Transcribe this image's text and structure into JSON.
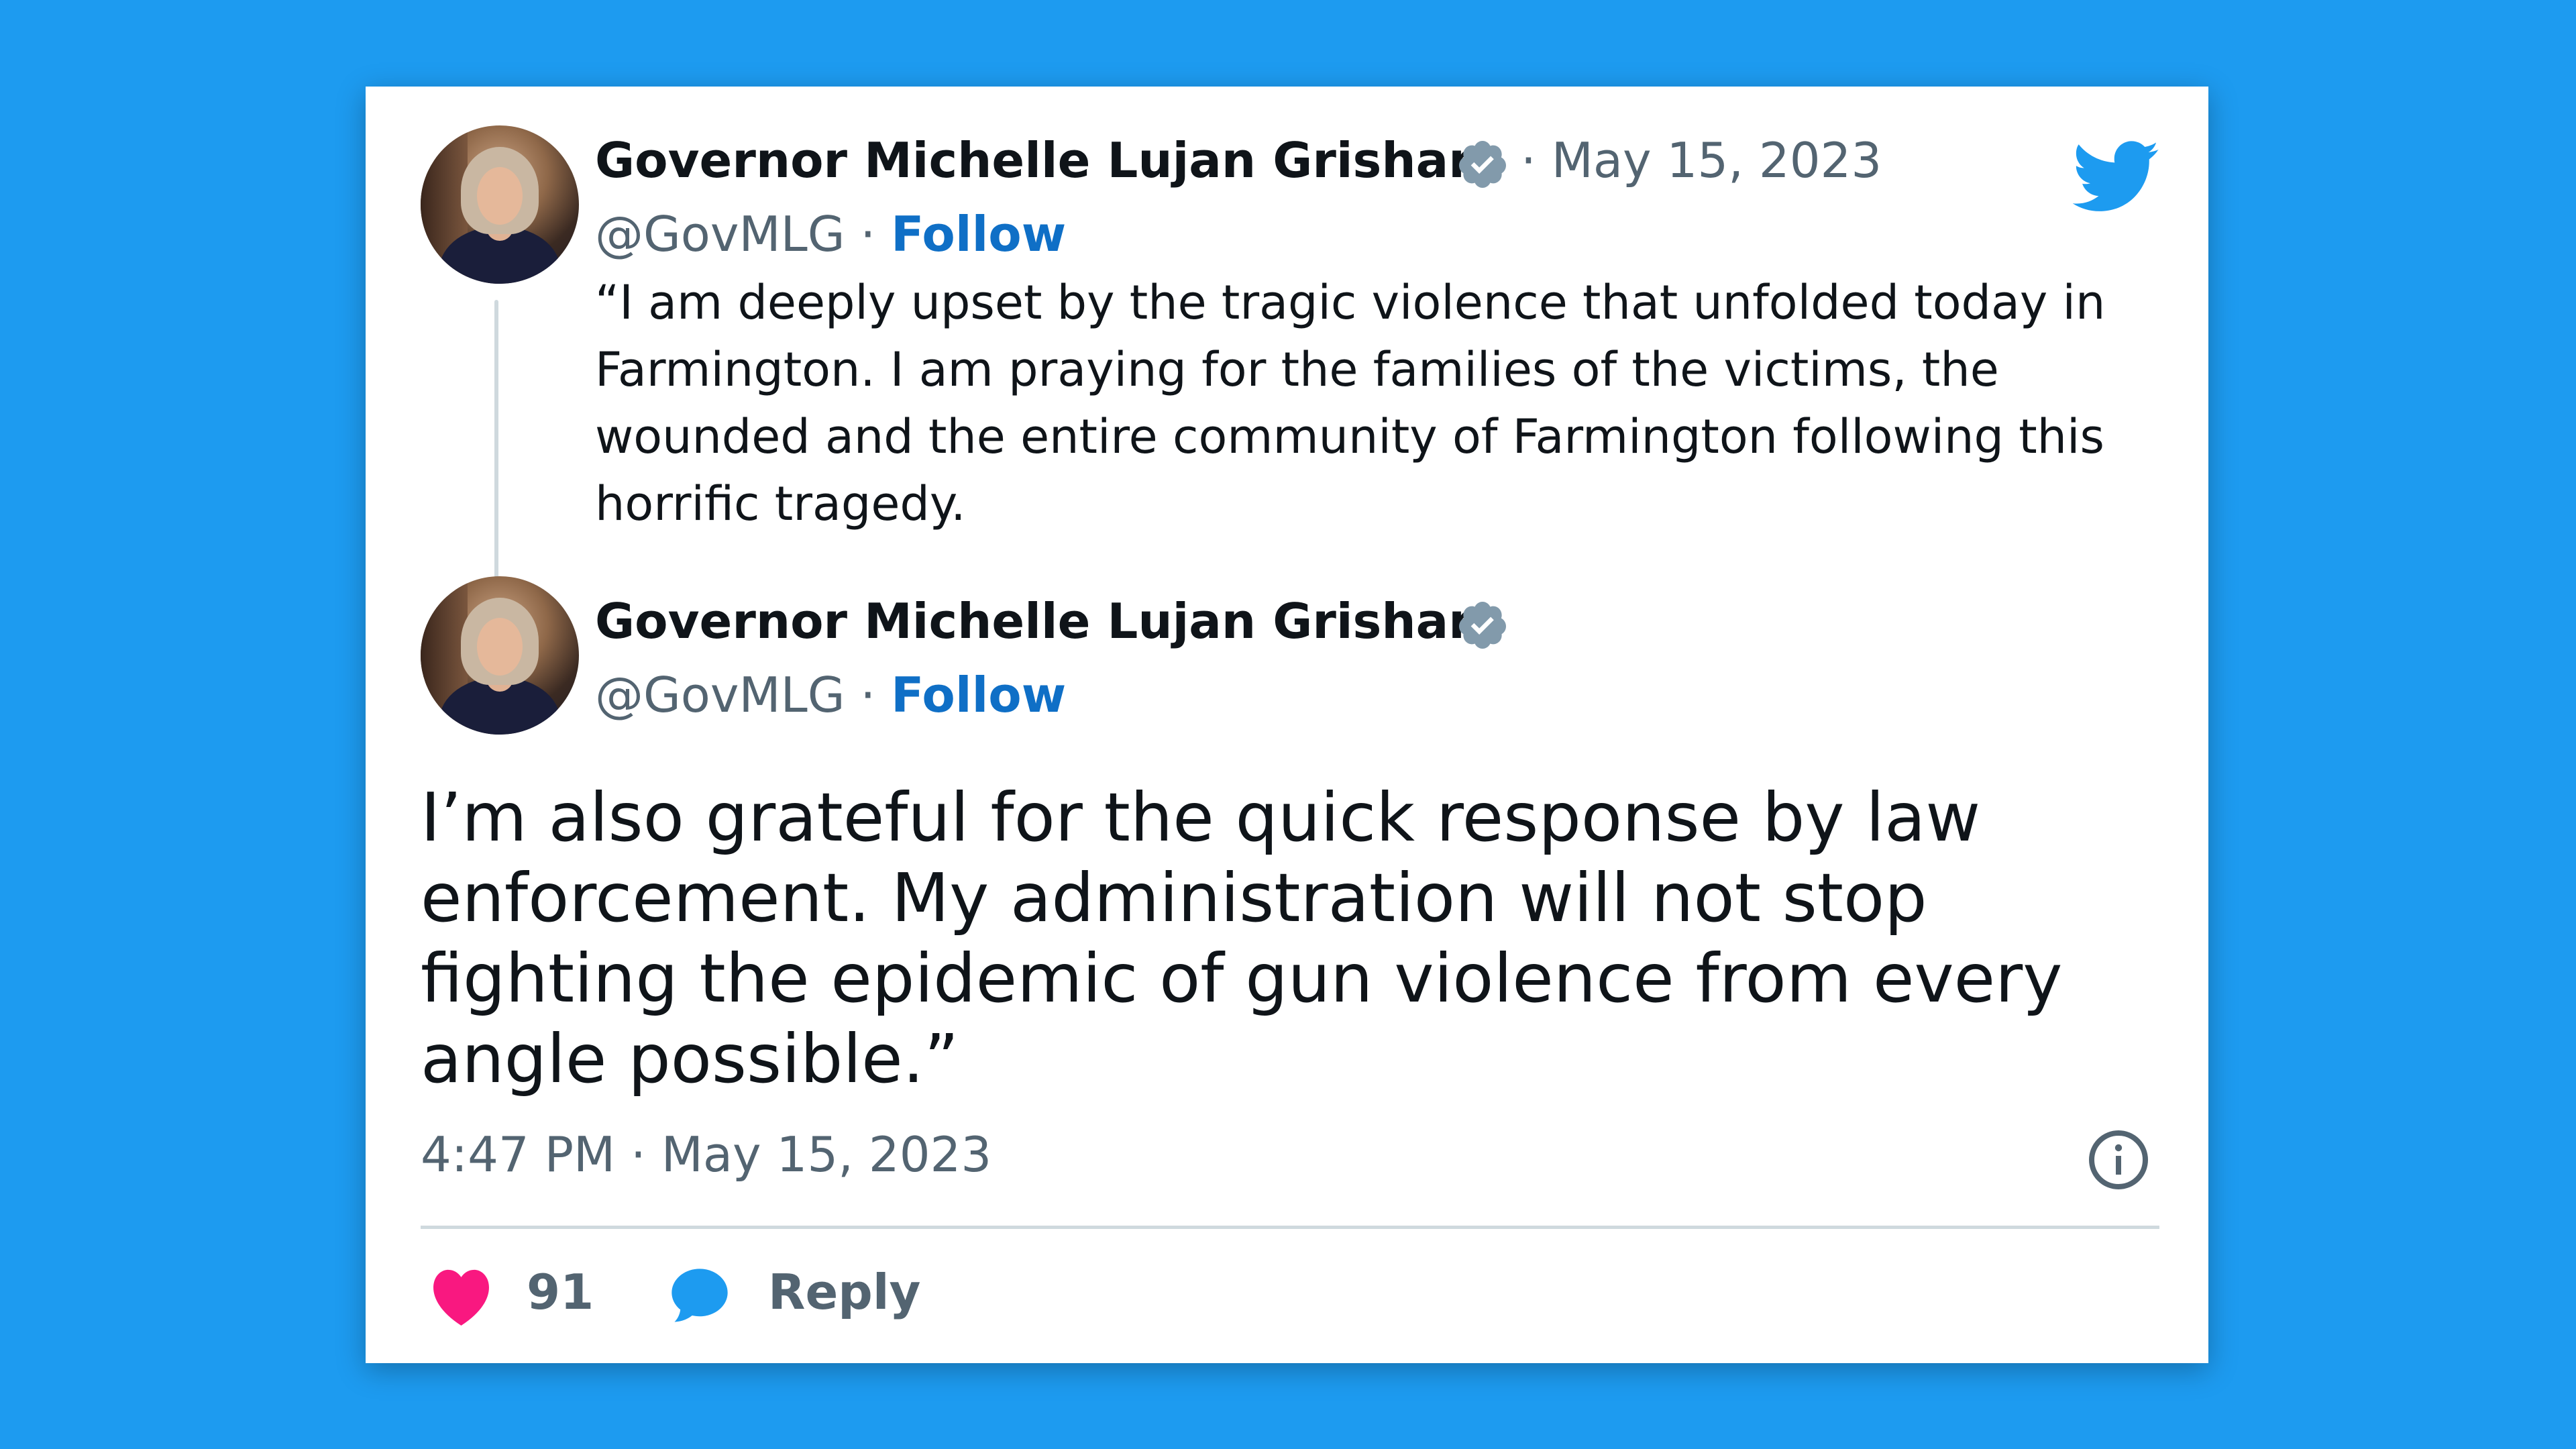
{
  "tweet_parent": {
    "display_name": "Governor Michelle Lujan Grisham",
    "date": "May 15, 2023",
    "handle": "@GovMLG",
    "follow_label": "Follow",
    "text": "“I am deeply upset by the tragic violence that unfolded today in Farmington. I am praying for the families of the victims, the wounded and the entire community of Farmington following this horrific tragedy."
  },
  "tweet_main": {
    "display_name": "Governor Michelle Lujan Grisham",
    "handle": "@GovMLG",
    "follow_label": "Follow",
    "text": "I’m also grateful for the quick response by law enforcement. My administration will not stop fighting the epidemic of gun violence from every angle possible.”",
    "timestamp": "4:47 PM · May 15, 2023",
    "like_count": "91",
    "reply_label": "Reply"
  },
  "separators": {
    "dot": "·"
  },
  "icons": {
    "brand": "twitter-bird-icon",
    "verified": "verified-badge-icon",
    "info": "info-icon",
    "like": "heart-icon",
    "reply": "reply-bubble-icon"
  },
  "colors": {
    "background": "#1d9bf0",
    "follow": "#0f6fc6",
    "heart": "#f91880",
    "reply": "#1d9bf0",
    "muted_text": "#536471",
    "verified_badge": "#829aab"
  }
}
